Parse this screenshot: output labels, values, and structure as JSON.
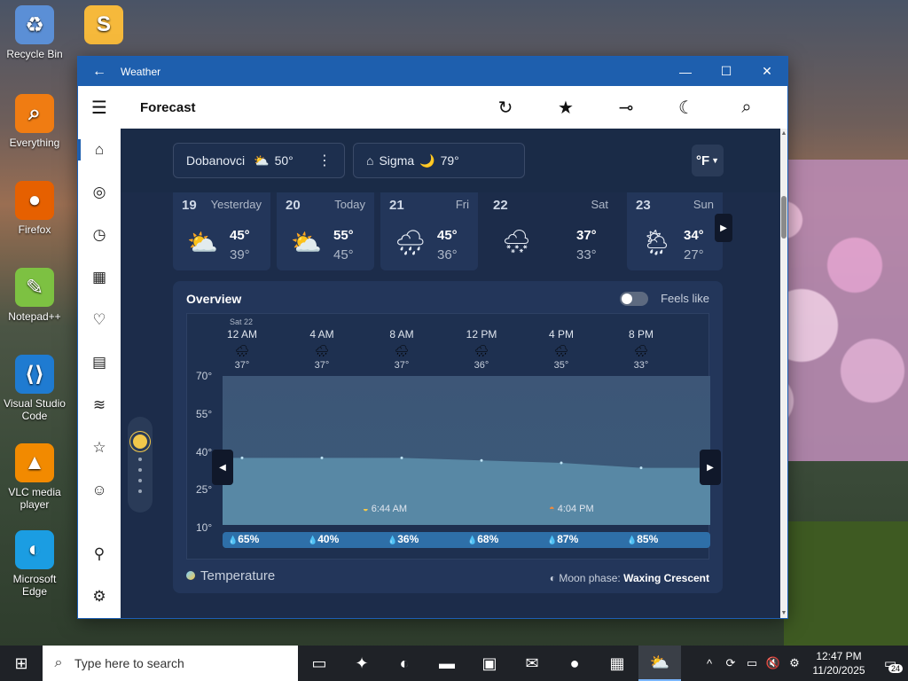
{
  "desktop": {
    "icons": [
      {
        "label": "Recycle Bin",
        "icon": "recycle-bin-icon",
        "glyph": "♻",
        "color": "#5b8fd6"
      },
      {
        "label": "Everything",
        "icon": "everything-search-icon",
        "glyph": "⌕",
        "color": "#f07c12"
      },
      {
        "label": "Firefox",
        "icon": "firefox-icon",
        "glyph": "●",
        "color": "#e66000"
      },
      {
        "label": "Notepad++",
        "icon": "notepad-plus-plus-icon",
        "glyph": "✎",
        "color": "#7dc142"
      },
      {
        "label": "Visual Studio Code",
        "icon": "vscode-icon",
        "glyph": "⟨⟩",
        "color": "#1f7bd1"
      },
      {
        "label": "VLC media player",
        "icon": "vlc-icon",
        "glyph": "▲",
        "color": "#f28a00"
      },
      {
        "label": "Microsoft Edge",
        "icon": "edge-icon",
        "glyph": "◐",
        "color": "#1b9de2"
      }
    ],
    "top_icon": {
      "label": "Scratch 3",
      "icon": "scratch-icon",
      "glyph": "S",
      "color": "#f6b93b"
    }
  },
  "window": {
    "title": "Weather",
    "back_glyph": "←",
    "min_glyph": "—",
    "max_glyph": "☐",
    "close_glyph": "✕"
  },
  "appbar": {
    "menu_glyph": "☰",
    "title": "Forecast",
    "refresh_glyph": "↻",
    "favorite_glyph": "★",
    "pin_glyph": "⊸",
    "theme_glyph": "☾",
    "search_glyph": "⌕"
  },
  "nav": {
    "items": [
      {
        "name": "nav-forecast",
        "icon": "home-icon",
        "glyph": "⌂"
      },
      {
        "name": "nav-radar",
        "icon": "radar-icon",
        "glyph": "◎"
      },
      {
        "name": "nav-hourly",
        "icon": "clock-icon",
        "glyph": "◷"
      },
      {
        "name": "nav-monthly",
        "icon": "calendar-icon",
        "glyph": "▦"
      },
      {
        "name": "nav-health",
        "icon": "heart-icon",
        "glyph": "♡"
      },
      {
        "name": "nav-life",
        "icon": "building-icon",
        "glyph": "▤"
      },
      {
        "name": "nav-historical",
        "icon": "chart-icon",
        "glyph": "≋"
      },
      {
        "name": "nav-favorites",
        "icon": "favorites-list-icon",
        "glyph": "☆"
      },
      {
        "name": "nav-feedback",
        "icon": "smiley-icon",
        "glyph": "☺"
      }
    ],
    "bottom": [
      {
        "name": "nav-account",
        "icon": "add-user-icon",
        "glyph": "⚲"
      },
      {
        "name": "nav-settings",
        "icon": "gear-icon",
        "glyph": "⚙"
      }
    ]
  },
  "locations": [
    {
      "name": "Dobanovci",
      "icon": "partly-sunny-icon",
      "glyph": "⛅",
      "temp": "50°",
      "more": "⋮"
    },
    {
      "name": "Sigma",
      "icon": "moon-cloud-icon",
      "glyph": "🌙",
      "temp": "79°",
      "home_glyph": "⌂"
    }
  ],
  "unit": "°F",
  "days": [
    {
      "num": "19",
      "name": "Yesterday",
      "glyph": "⛅",
      "icon": "partly-cloudy-icon",
      "hi": "45°",
      "lo": "39°"
    },
    {
      "num": "20",
      "name": "Today",
      "glyph": "⛅",
      "icon": "partly-cloudy-icon",
      "hi": "55°",
      "lo": "45°"
    },
    {
      "num": "21",
      "name": "Fri",
      "glyph": "🌧",
      "icon": "rain-icon",
      "hi": "45°",
      "lo": "36°"
    },
    {
      "num": "22",
      "name": "Sat",
      "glyph": "🌨",
      "icon": "snow-rain-icon",
      "hi": "37°",
      "lo": "33°"
    },
    {
      "num": "23",
      "name": "Sun",
      "glyph": "🌦",
      "icon": "sun-snow-icon",
      "hi": "34°",
      "lo": "27°"
    }
  ],
  "overview": {
    "title": "Overview",
    "feels_like": "Feels like",
    "date_tag": "Sat 22",
    "hours": [
      {
        "time": "12 AM",
        "temp": "37°",
        "glyph": "🌧"
      },
      {
        "time": "4 AM",
        "temp": "37°",
        "glyph": "🌧"
      },
      {
        "time": "8 AM",
        "temp": "37°",
        "glyph": "🌧"
      },
      {
        "time": "12 PM",
        "temp": "36°",
        "glyph": "🌧"
      },
      {
        "time": "4 PM",
        "temp": "35°",
        "glyph": "🌧"
      },
      {
        "time": "8 PM",
        "temp": "33°",
        "glyph": "🌧"
      }
    ],
    "y_ticks": [
      "70°",
      "55°",
      "40°",
      "25°",
      "10°"
    ],
    "sunrise": "6:44 AM",
    "sunset": "4:04 PM",
    "precip": [
      "65%",
      "40%",
      "36%",
      "68%",
      "87%",
      "85%"
    ],
    "layer": "Temperature",
    "moon_label": "Moon phase:",
    "moon_value": "Waxing Crescent"
  },
  "chart_data": {
    "type": "area",
    "x": [
      "12 AM",
      "4 AM",
      "8 AM",
      "12 PM",
      "4 PM",
      "8 PM"
    ],
    "series": [
      {
        "values": [
          37,
          37,
          37,
          36,
          35,
          33
        ]
      }
    ],
    "ylim": [
      10,
      70
    ],
    "y_ticks": [
      70,
      55,
      40,
      25,
      10
    ]
  },
  "taskbar": {
    "search_placeholder": "Type here to search",
    "apps": [
      {
        "name": "task-view",
        "icon": "task-view-icon",
        "glyph": "▭"
      },
      {
        "name": "copilot",
        "icon": "copilot-icon",
        "glyph": "✦"
      },
      {
        "name": "edge",
        "icon": "edge-icon",
        "glyph": "◐"
      },
      {
        "name": "file-explorer",
        "icon": "folder-icon",
        "glyph": "▬"
      },
      {
        "name": "store",
        "icon": "store-icon",
        "glyph": "▣"
      },
      {
        "name": "outlook",
        "icon": "mail-icon",
        "glyph": "✉"
      },
      {
        "name": "firefox",
        "icon": "firefox-icon",
        "glyph": "●"
      },
      {
        "name": "notes",
        "icon": "notes-icon",
        "glyph": "▦"
      },
      {
        "name": "weather",
        "icon": "weather-icon",
        "glyph": "⛅"
      }
    ],
    "time": "12:47 PM",
    "date": "11/20/2025",
    "notif_count": "24"
  }
}
